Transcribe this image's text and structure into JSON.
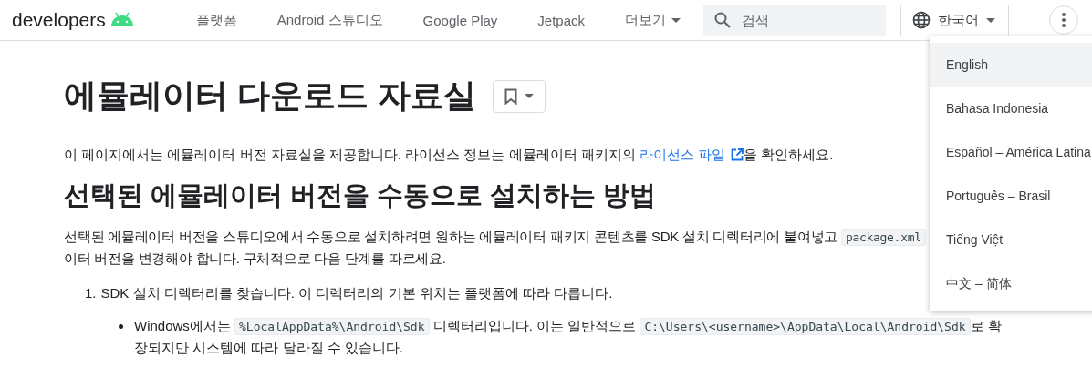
{
  "header": {
    "logo": "developers",
    "nav": [
      {
        "label": "플랫폼",
        "has_menu": false
      },
      {
        "label": "Android 스튜디오",
        "has_menu": false
      },
      {
        "label": "Google Play",
        "has_menu": false
      },
      {
        "label": "Jetpack",
        "has_menu": false
      },
      {
        "label": "더보기",
        "has_menu": true
      }
    ],
    "search": {
      "placeholder": "검색"
    },
    "language": "한국어"
  },
  "page": {
    "title": "에뮬레이터 다운로드 자료실",
    "intro": [
      {
        "kind": "text",
        "text": "이 페이지에서는 에뮬레이터 버전 자료실을 제공합니다. 라이선스 정보는 에뮬레이터 패키지의 "
      },
      {
        "kind": "link",
        "text": "라이선스 파일"
      },
      {
        "kind": "text",
        "text": "을 확인하세요."
      }
    ],
    "heading": "선택된 에뮬레이터 버전을 수동으로 설치하는 방법",
    "paragraph_lines": [
      [
        {
          "kind": "text",
          "text": "선택된 에뮬레이터 버전을 스튜디오에서 수동으로 설치하려면 원하는 에뮬레이터 패키지 콘텐츠를 SDK 설치 디렉터리에 붙여넣고 "
        },
        {
          "kind": "code",
          "text": "package.xml"
        }
      ],
      [
        {
          "kind": "text",
          "text": "이터 버전을 변경해야 합니다. 구체적으로 다음 단계를 따르세요."
        }
      ]
    ],
    "steps": [
      {
        "number": "1.",
        "text": "SDK 설치 디렉터리를 찾습니다. 이 디렉터리의 기본 위치는 플랫폼에 따라 다릅니다.",
        "bullets": [
          {
            "lines": [
              [
                {
                  "kind": "text",
                  "text": "Windows에서는 "
                },
                {
                  "kind": "code",
                  "text": "%LocalAppData%\\Android\\Sdk"
                },
                {
                  "kind": "text",
                  "text": " 디렉터리입니다. 이는 일반적으로 "
                },
                {
                  "kind": "code",
                  "text": "C:\\Users\\<username>\\AppData\\Local\\Android\\Sdk"
                },
                {
                  "kind": "text",
                  "text": "로 확"
                }
              ],
              [
                {
                  "kind": "text",
                  "text": "장되지만 시스템에 따라 달라질 수 있습니다."
                }
              ]
            ]
          }
        ]
      }
    ]
  },
  "language_menu": [
    {
      "label": "English",
      "selected": true
    },
    {
      "label": "Bahasa Indonesia",
      "selected": false
    },
    {
      "label": "Español – América Latina",
      "selected": false
    },
    {
      "label": "Português – Brasil",
      "selected": false
    },
    {
      "label": "Tiếng Việt",
      "selected": false
    },
    {
      "label": "中文 – 简体",
      "selected": false
    }
  ]
}
